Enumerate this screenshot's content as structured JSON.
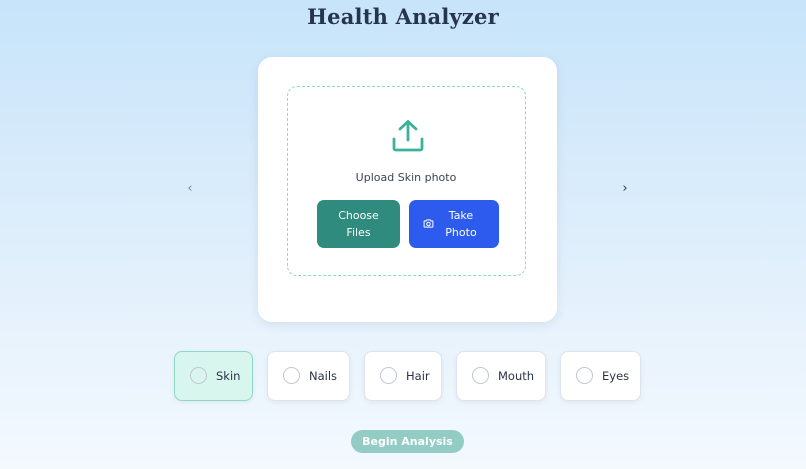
{
  "app": {
    "title": "Health Analyzer"
  },
  "carousel": {
    "prev_label": "‹",
    "next_label": "›"
  },
  "upload": {
    "icon": "upload-icon",
    "label": "Upload Skin photo",
    "choose_files_label": "Choose Files",
    "take_photo_label": "Take Photo",
    "take_photo_icon": "camera-icon"
  },
  "categories": [
    {
      "label": "Skin",
      "selected": true
    },
    {
      "label": "Nails",
      "selected": false
    },
    {
      "label": "Hair",
      "selected": false
    },
    {
      "label": "Mouth",
      "selected": false
    },
    {
      "label": "Eyes",
      "selected": false
    }
  ],
  "actions": {
    "begin_label": "Begin Analysis"
  },
  "colors": {
    "accent_teal": "#2e8b7e",
    "accent_blue": "#2d5bed",
    "selected_bg": "#d9f6ee",
    "dashed_border": "#8ed8c4",
    "disabled_button": "#93cbc5"
  }
}
